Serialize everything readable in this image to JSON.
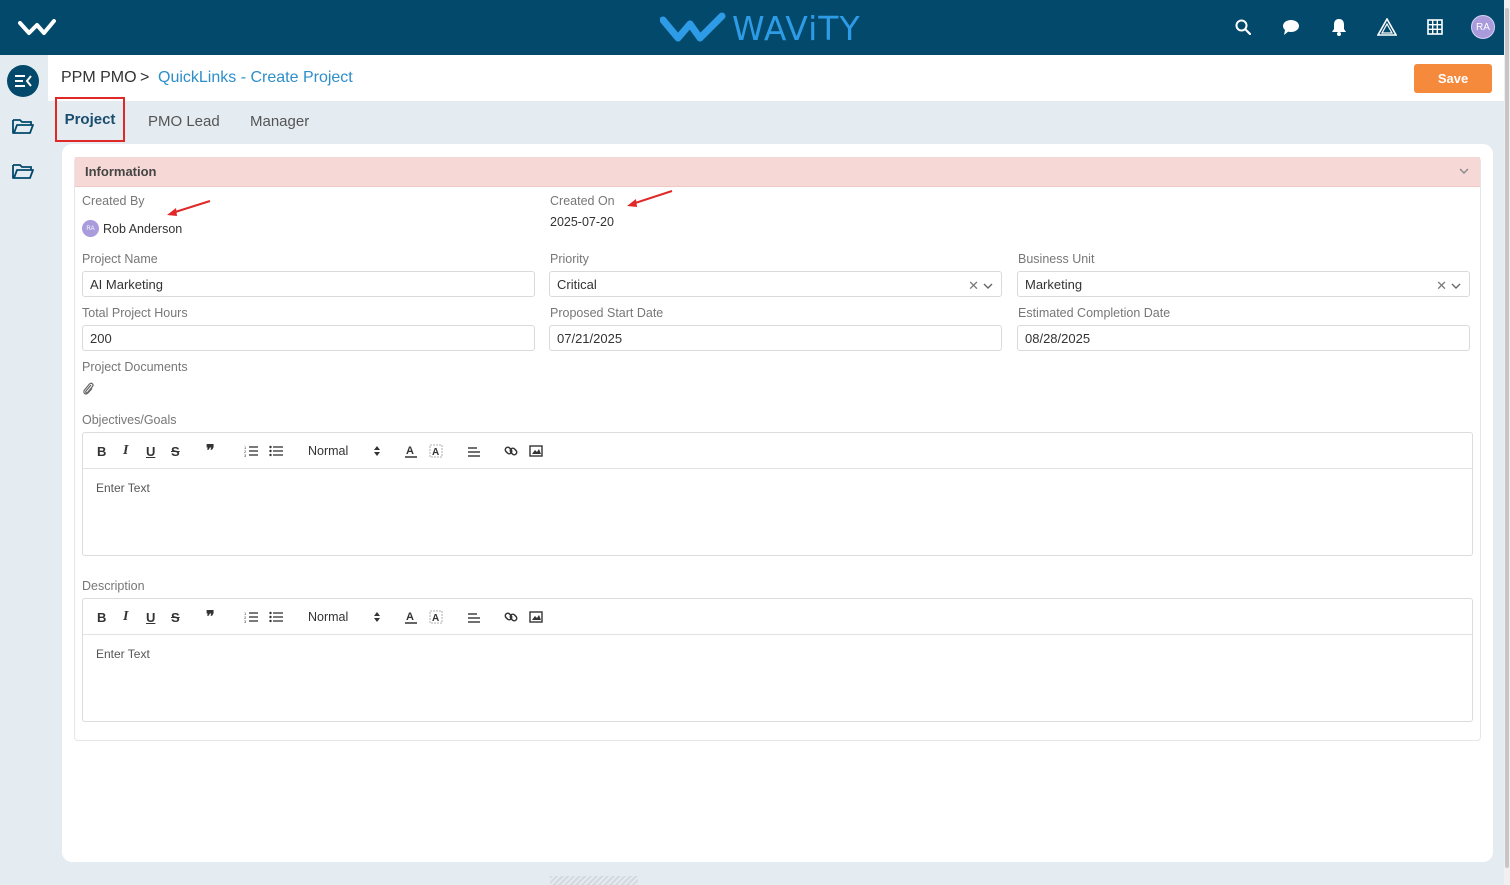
{
  "topbar": {
    "brand": "WAViTY",
    "avatar_initials": "RA",
    "icons": [
      "search-icon",
      "chat-icon",
      "bell-icon",
      "warning-icon",
      "grid-icon"
    ]
  },
  "sidebar": {
    "icons": [
      "sidebar-toggle-icon",
      "folder-icon",
      "folder-icon"
    ]
  },
  "breadcrumb": {
    "root": "PPM PMO",
    "separator": ">",
    "current": "QuickLinks - Create Project"
  },
  "actions": {
    "save_label": "Save"
  },
  "tabs": [
    {
      "label": "Project",
      "active": true
    },
    {
      "label": "PMO Lead",
      "active": false
    },
    {
      "label": "Manager",
      "active": false
    }
  ],
  "section": {
    "title": "Information"
  },
  "fields": {
    "created_by": {
      "label": "Created By",
      "value": "Rob Anderson",
      "avatar": "RA"
    },
    "created_on": {
      "label": "Created On",
      "value": "2025-07-20"
    },
    "project_name": {
      "label": "Project Name",
      "value": "AI Marketing"
    },
    "priority": {
      "label": "Priority",
      "value": "Critical"
    },
    "business_unit": {
      "label": "Business Unit",
      "value": "Marketing"
    },
    "total_hours": {
      "label": "Total Project Hours",
      "value": "200"
    },
    "start_date": {
      "label": "Proposed Start Date",
      "value": "07/21/2025"
    },
    "completion_date": {
      "label": "Estimated Completion Date",
      "value": "08/28/2025"
    },
    "documents": {
      "label": "Project Documents"
    },
    "objectives": {
      "label": "Objectives/Goals",
      "placeholder": "Enter Text",
      "format": "Normal"
    },
    "description": {
      "label": "Description",
      "placeholder": "Enter Text",
      "format": "Normal"
    }
  },
  "colors": {
    "topbar": "#03496b",
    "accent": "#2d9be6",
    "save": "#f58a3c",
    "section_header": "#f6d9d6",
    "highlight": "#e02828"
  }
}
